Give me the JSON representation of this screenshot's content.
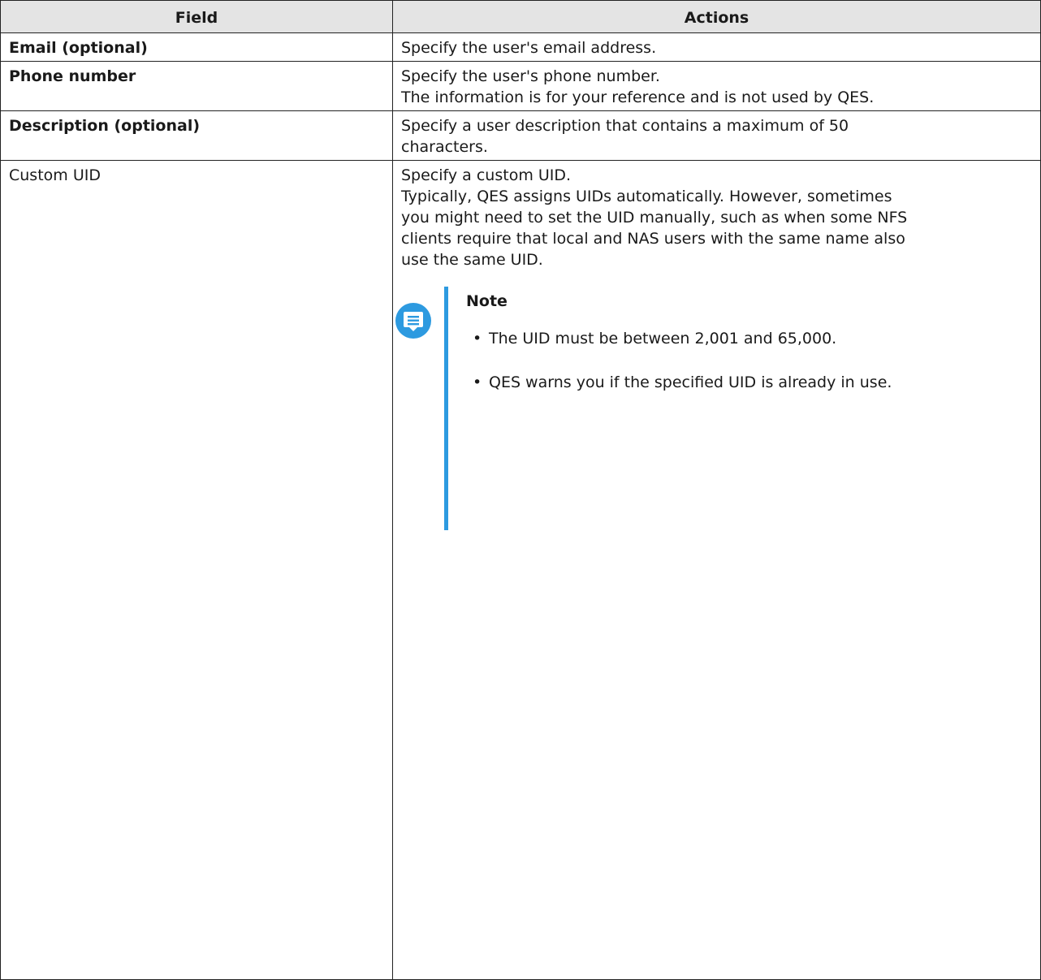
{
  "table": {
    "headers": {
      "field": "Field",
      "actions": "Actions"
    },
    "rows": [
      {
        "field": "Email (optional)",
        "actions": [
          "Specify the user's email address."
        ]
      },
      {
        "field": "Phone number",
        "actions": [
          "Specify the user's phone number.",
          "The information is for your reference and is not used by QES."
        ]
      },
      {
        "field": "Description (optional)",
        "actions": [
          "Specify a user description that contains a maximum of 50",
          "characters."
        ]
      },
      {
        "field": "Custom UID",
        "actions": [
          "Specify a custom UID.",
          "Typically, QES assigns UIDs automatically. However, sometimes",
          "you might need to set the UID manually, such as when some NFS",
          "clients require that local and NAS users with the same name also",
          "use the same UID."
        ],
        "note": {
          "icon": "note-icon",
          "title": "Note",
          "items": [
            "The UID must be between 2,001 and 65,000.",
            "QES warns you if the specified UID is already in use."
          ]
        }
      }
    ]
  },
  "colors": {
    "header_background": "#e4e4e4",
    "border": "#222222",
    "note_accent": "#2d9ae0"
  }
}
